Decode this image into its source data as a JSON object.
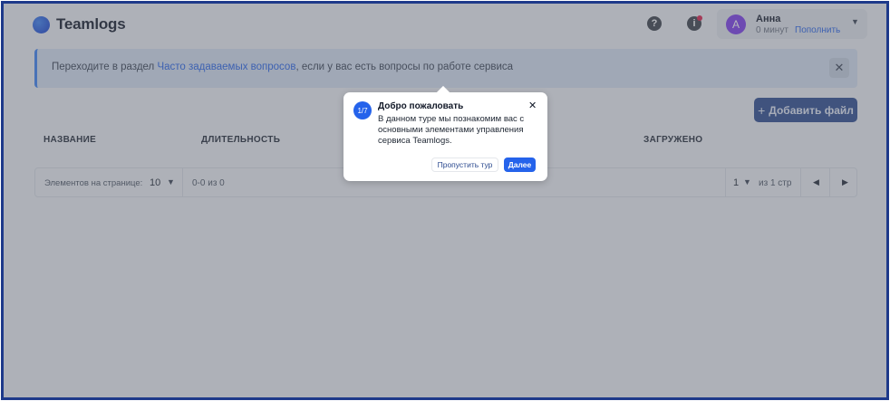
{
  "header": {
    "logo_text": "Teamlogs",
    "help_icon_glyph": "?",
    "info_icon_glyph": "i",
    "user": {
      "avatar_letter": "A",
      "name": "Анна",
      "time": "0 минут",
      "topup_link": "Пополнить"
    }
  },
  "banner": {
    "text_before": "Переходите в раздел ",
    "link": "Часто задаваемых вопросов",
    "text_after": ", если у вас есть вопросы по работе сервиса",
    "close_glyph": "✕"
  },
  "toolbar": {
    "add_file_label": "Добавить файл"
  },
  "table": {
    "columns": [
      "НАЗВАНИЕ",
      "ДЛИТЕЛЬНОСТЬ",
      "ЗАГРУЖЕНО"
    ]
  },
  "pagination": {
    "page_size_label": "Элементов на странице:",
    "page_size": "10",
    "range": "0-0 из 0",
    "page": "1",
    "of_pages": "из 1 стр"
  },
  "tour": {
    "step": "1/7",
    "title": "Добро пожаловать",
    "body": "В данном туре мы познакомим вас с основными элементами управления сервиса Teamlogs.",
    "skip_label": "Пропустить тур",
    "next_label": "Далее"
  },
  "colors": {
    "accent": "#2563eb",
    "primary_button": "#2b4a8f",
    "frame_border": "#1e3a8a"
  }
}
